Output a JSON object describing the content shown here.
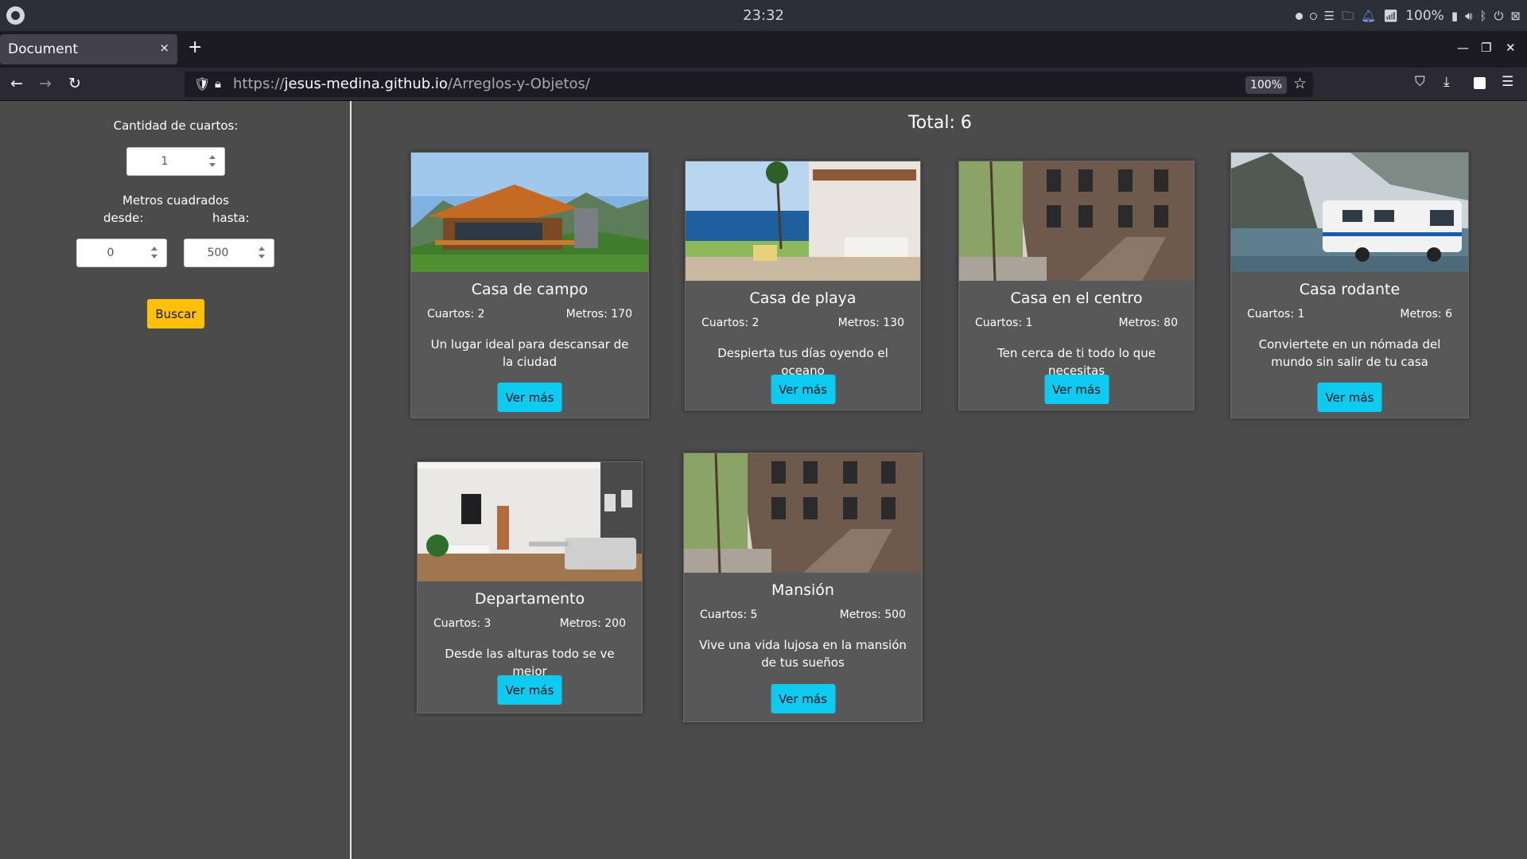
{
  "os": {
    "clock": "23:32",
    "battery": "100%",
    "icons": [
      "activity-dots-icon",
      "menu-icon",
      "folder-icon",
      "bell-icon",
      "wifi-icon",
      "battery-icon",
      "volume-icon",
      "bluetooth-icon",
      "power-icon",
      "screen-icon"
    ]
  },
  "browser": {
    "tab_title": "Document",
    "tab_close": "×",
    "new_tab": "+",
    "url_prefix": "https://",
    "url_host": "jesus-medina.github.io",
    "url_path": "/Arreglos-y-Objetos/",
    "zoom": "100%"
  },
  "sidebar": {
    "rooms_label": "Cantidad de cuartos:",
    "rooms_value": "1",
    "meters_label": "Metros cuadrados",
    "from_label": "desde:",
    "to_label": "hasta:",
    "from_value": "0",
    "to_value": "500",
    "search_button": "Buscar"
  },
  "main": {
    "total": "Total: 6",
    "view_more": "Ver más",
    "cards": [
      {
        "title": "Casa de campo",
        "rooms": "Cuartos: 2",
        "meters": "Metros: 170",
        "desc": "Un lugar ideal para descansar de la ciudad",
        "image": "country-house-photo"
      },
      {
        "title": "Casa de playa",
        "rooms": "Cuartos: 2",
        "meters": "Metros: 130",
        "desc": "Despierta tus días oyendo el oceano",
        "image": "beach-house-photo"
      },
      {
        "title": "Casa en el centro",
        "rooms": "Cuartos: 1",
        "meters": "Metros: 80",
        "desc": "Ten cerca de ti todo lo que necesitas",
        "image": "brownstone-street-photo"
      },
      {
        "title": "Casa rodante",
        "rooms": "Cuartos: 1",
        "meters": "Metros: 6",
        "desc": "Conviertete en un nómada del mundo sin salir de tu casa",
        "image": "camper-van-photo"
      },
      {
        "title": "Departamento",
        "rooms": "Cuartos: 3",
        "meters": "Metros: 200",
        "desc": "Desde las alturas todo se ve mejor",
        "image": "apartment-interior-photo"
      },
      {
        "title": "Mansión",
        "rooms": "Cuartos: 5",
        "meters": "Metros: 500",
        "desc": "Vive una vida lujosa en la mansión de tus sueños",
        "image": "brownstone-street-photo"
      }
    ]
  },
  "colors": {
    "page_bg": "#4b4b4b",
    "card_bg": "#585858",
    "search_button": "#ffc107",
    "view_button": "#0dcaf0"
  }
}
